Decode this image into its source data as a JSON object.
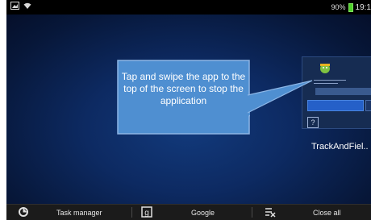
{
  "status_bar": {
    "battery_text": "90%",
    "clock": "19:1"
  },
  "callout": {
    "text": "Tap and swipe the app to the top of the screen to stop the application"
  },
  "recent_app": {
    "name": "TrackAndFiel.."
  },
  "bottom_bar": {
    "task_manager_label": "Task manager",
    "google_label": "Google",
    "close_all_label": "Close all"
  }
}
